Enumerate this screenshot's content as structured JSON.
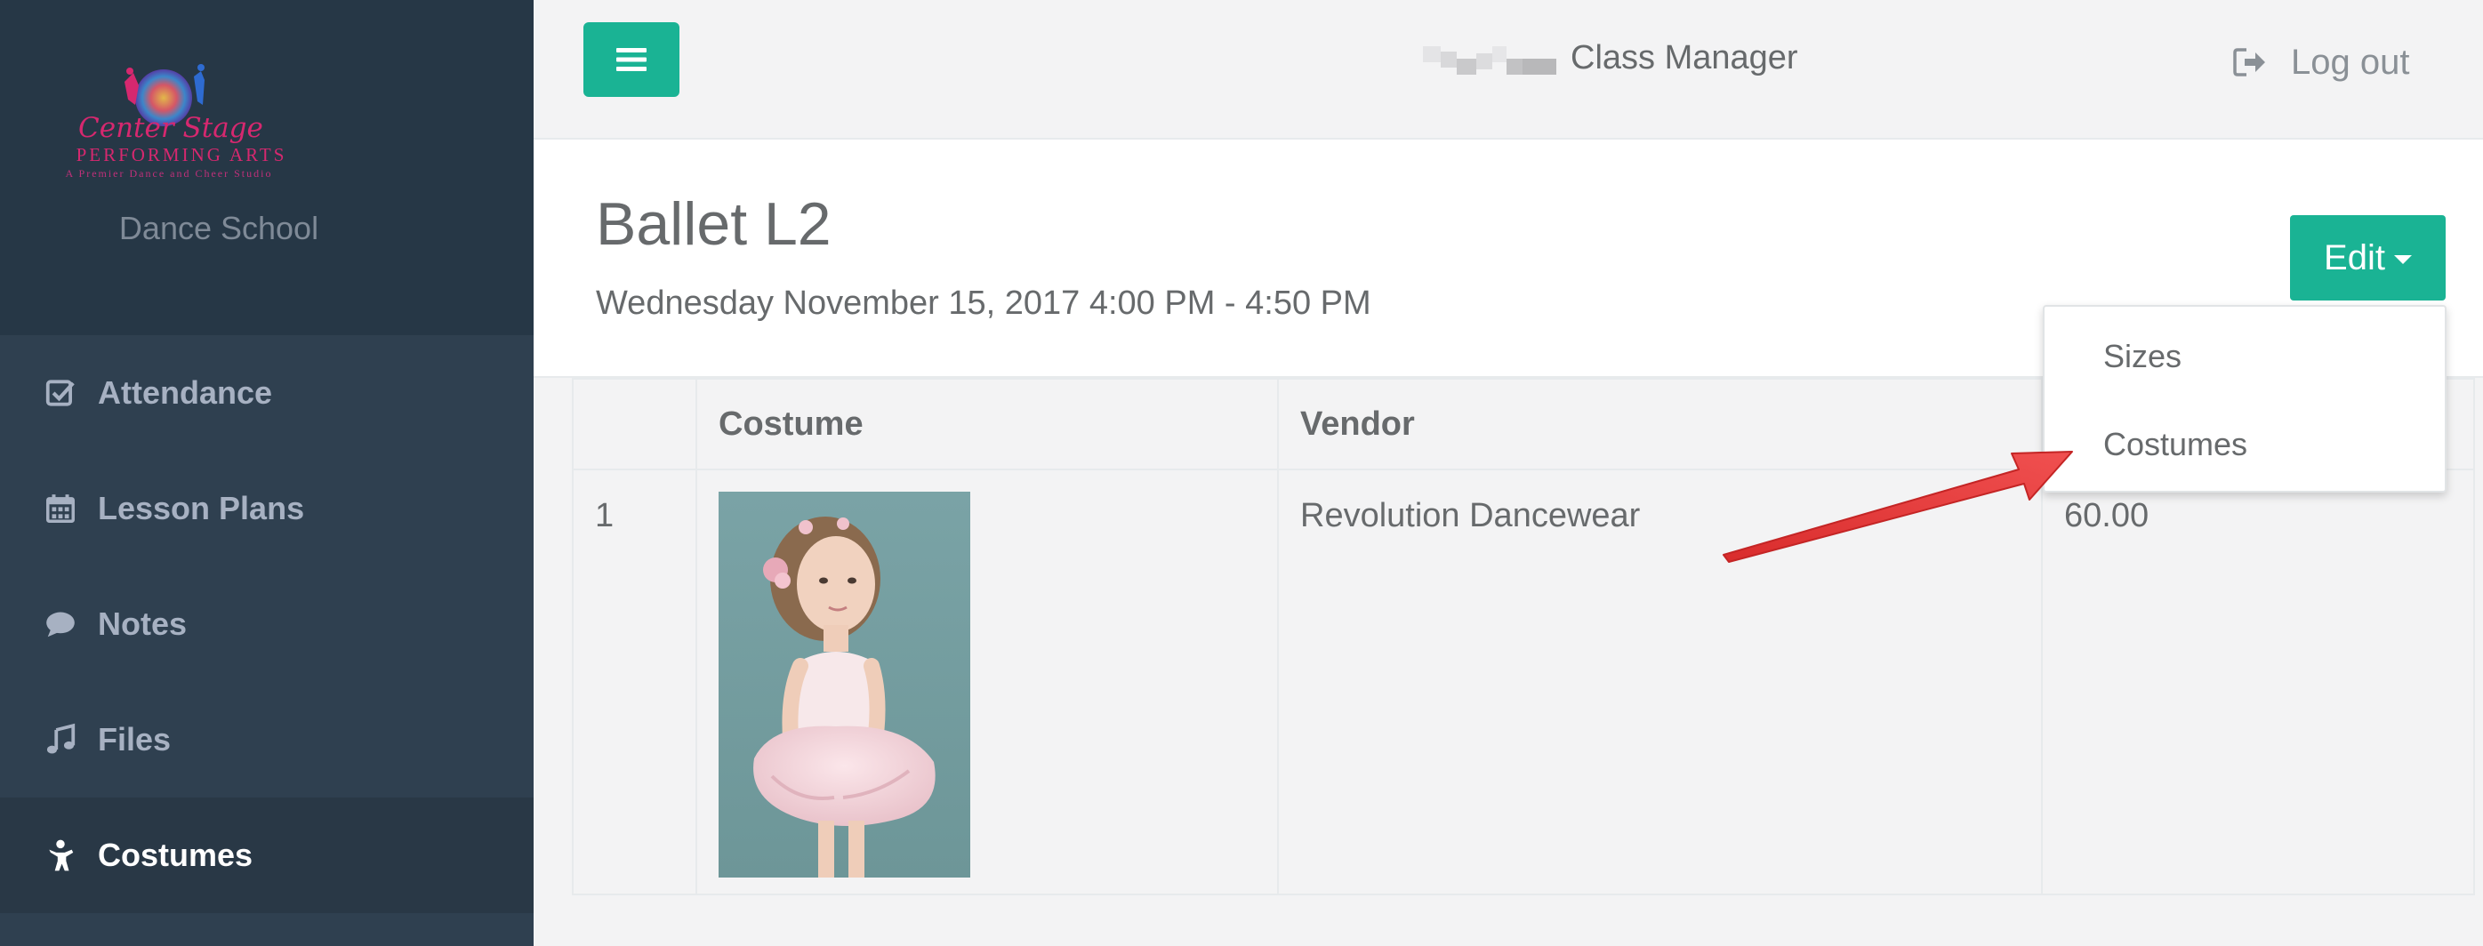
{
  "sidebar": {
    "logo": {
      "title": "Center Stage",
      "subtitle": "PERFORMING ARTS",
      "tagline": "A Premier Dance and Cheer Studio"
    },
    "school_name": "Dance School",
    "items": [
      {
        "label": "Attendance",
        "icon": "check-square-icon"
      },
      {
        "label": "Lesson Plans",
        "icon": "calendar-icon"
      },
      {
        "label": "Notes",
        "icon": "comment-icon"
      },
      {
        "label": "Files",
        "icon": "music-icon"
      },
      {
        "label": "Costumes",
        "icon": "child-icon",
        "active": true
      }
    ]
  },
  "header": {
    "app_title": "Class Manager",
    "logout_label": "Log out"
  },
  "page": {
    "title": "Ballet L2",
    "subtitle": "Wednesday November 15, 2017 4:00 PM - 4:50 PM",
    "edit_label": "Edit"
  },
  "edit_menu": {
    "items": [
      "Sizes",
      "Costumes"
    ]
  },
  "table": {
    "columns": [
      "",
      "Costume",
      "Vendor",
      ""
    ],
    "rows": [
      {
        "index": "1",
        "vendor": "Revolution Dancewear",
        "price": "60.00"
      }
    ]
  },
  "colors": {
    "accent": "#1ab394",
    "sidebar": "#2f4050",
    "sidebar_header": "#263746",
    "annotation_arrow": "#e63a3a"
  }
}
